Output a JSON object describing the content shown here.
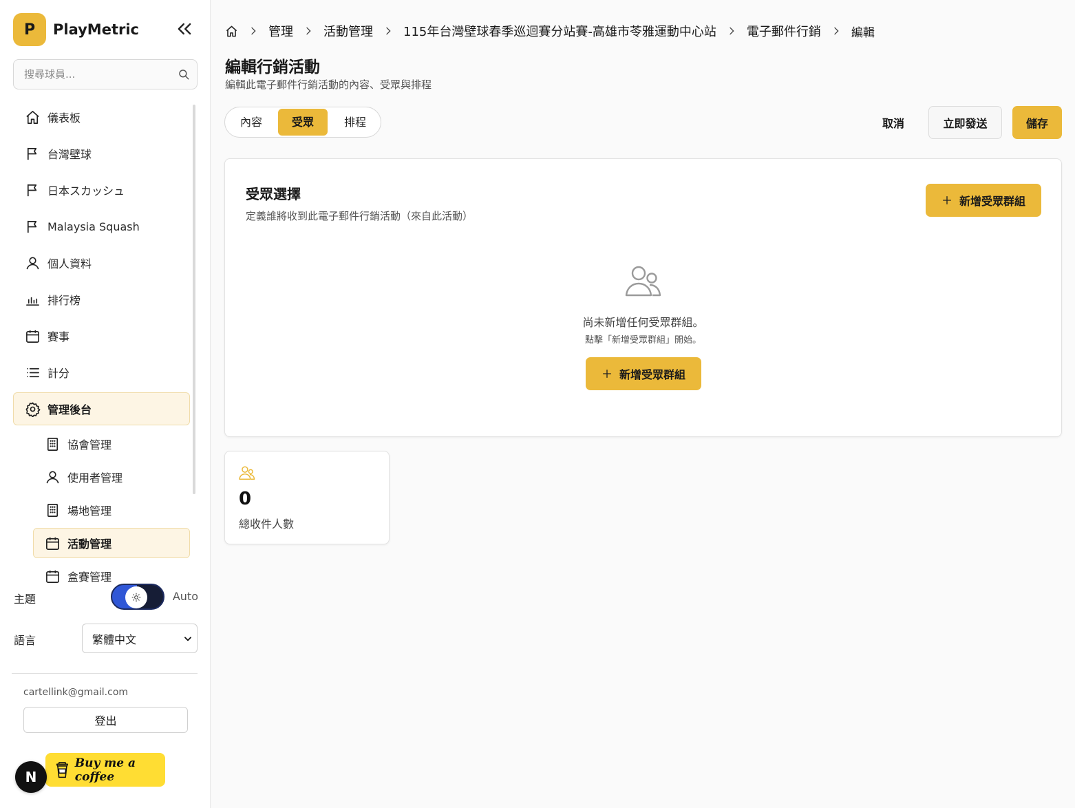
{
  "brand": {
    "logo_letter": "P",
    "name": "PlayMetric"
  },
  "search": {
    "placeholder": "搜尋球員..."
  },
  "nav": {
    "items": [
      {
        "label": "儀表板",
        "icon": "home-icon"
      },
      {
        "label": "台灣壁球",
        "icon": "flag-icon"
      },
      {
        "label": "日本スカッシュ",
        "icon": "flag-icon"
      },
      {
        "label": "Malaysia Squash",
        "icon": "flag-icon"
      },
      {
        "label": "個人資料",
        "icon": "user-icon"
      },
      {
        "label": "排行榜",
        "icon": "bar-chart-icon"
      },
      {
        "label": "賽事",
        "icon": "calendar-icon"
      },
      {
        "label": "計分",
        "icon": "list-icon"
      },
      {
        "label": "管理後台",
        "icon": "gear-icon",
        "active": true
      }
    ],
    "subitems": [
      {
        "label": "協會管理",
        "icon": "building-icon"
      },
      {
        "label": "使用者管理",
        "icon": "user-icon"
      },
      {
        "label": "場地管理",
        "icon": "building-icon"
      },
      {
        "label": "活動管理",
        "icon": "calendar-icon",
        "active": true
      },
      {
        "label": "盒賽管理",
        "icon": "calendar-icon"
      }
    ]
  },
  "theme": {
    "label": "主題",
    "value": "Auto"
  },
  "language": {
    "label": "語言",
    "selected": "繁體中文"
  },
  "user": {
    "email": "cartellink@gmail.com",
    "logout_label": "登出"
  },
  "badge": {
    "letter": "N"
  },
  "coffee": {
    "label": "Buy me a coffee"
  },
  "breadcrumb": {
    "items": [
      "管理",
      "活動管理",
      "115年台灣壁球春季巡迴賽分站賽-高雄市苓雅運動中心站",
      "電子郵件行銷"
    ],
    "current": "編輯"
  },
  "page": {
    "title": "編輯行銷活動",
    "subtitle": "編輯此電子郵件行銷活動的內容、受眾與排程"
  },
  "tabs": [
    {
      "label": "內容"
    },
    {
      "label": "受眾",
      "active": true
    },
    {
      "label": "排程"
    }
  ],
  "actions": {
    "cancel": "取消",
    "send_now": "立即發送",
    "save": "儲存"
  },
  "audience": {
    "title": "受眾選擇",
    "description": "定義誰將收到此電子郵件行銷活動（來自此活動）",
    "add_group_label": "新增受眾群組",
    "empty_title": "尚未新增任何受眾群組。",
    "empty_hint": "點擊「新增受眾群組」開始。"
  },
  "stats": {
    "value": "0",
    "label": "總收件人數"
  },
  "colors": {
    "accent": "#ebb93a",
    "active_bg": "#fdf5e4",
    "coffee": "#ffdd33"
  }
}
